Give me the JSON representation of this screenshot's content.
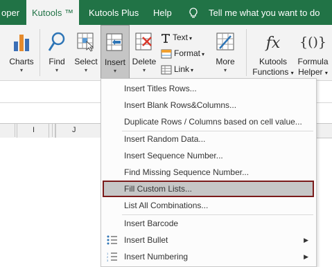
{
  "tabs": [
    {
      "label": "oper"
    },
    {
      "label": "Kutools ™"
    },
    {
      "label": "Kutools Plus"
    },
    {
      "label": "Help"
    }
  ],
  "tell_me": "Tell me what you want to do",
  "ribbon": {
    "charts": "Charts",
    "find": "Find",
    "select": "Select",
    "insert": "Insert",
    "delete": "Delete",
    "text": "Text",
    "format": "Format",
    "link": "Link",
    "more": "More",
    "kutools_functions_1": "Kutools",
    "kutools_functions_2": "Functions",
    "formula_helper_1": "Formula",
    "formula_helper_2": "Helper",
    "caret": "▾"
  },
  "columns": [
    "I",
    "J"
  ],
  "menu": {
    "items": [
      {
        "label": "Insert Titles Rows..."
      },
      {
        "label": "Insert Blank Rows&Columns..."
      },
      {
        "label": "Duplicate Rows / Columns based on cell value..."
      },
      {
        "label": "Insert Random Data..."
      },
      {
        "label": "Insert Sequence Number..."
      },
      {
        "label": "Find Missing Sequence Number..."
      },
      {
        "label": "Fill Custom Lists..."
      },
      {
        "label": "List All Combinations..."
      },
      {
        "label": "Insert Barcode"
      },
      {
        "label": "Insert Bullet"
      },
      {
        "label": "Insert Numbering"
      }
    ],
    "submenu_arrow": "▶"
  },
  "colors": {
    "tab_green": "#217346",
    "highlight_border": "#7a1a1a",
    "highlight_fill": "#c6c6c6"
  }
}
